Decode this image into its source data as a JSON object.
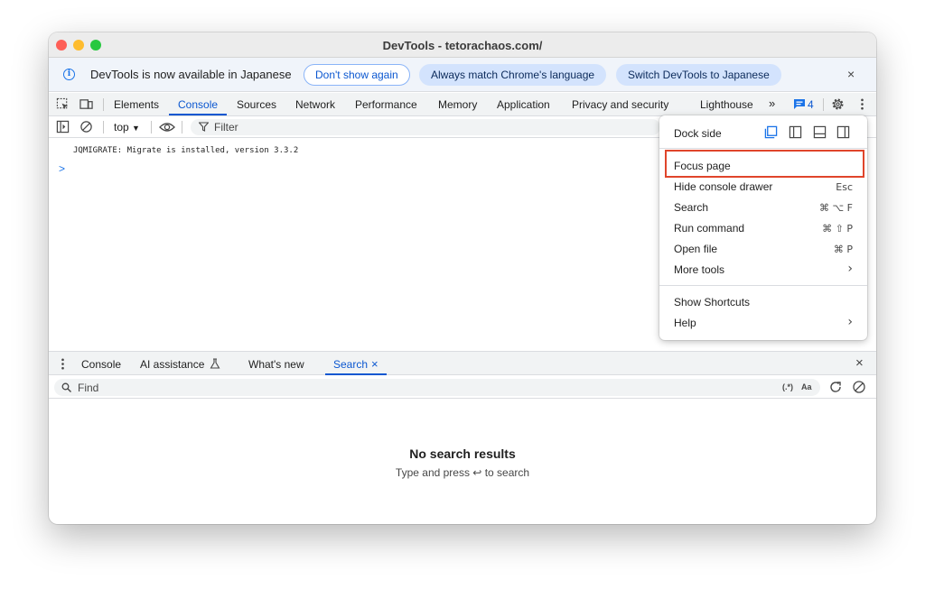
{
  "window": {
    "title": "DevTools - tetorachaos.com/"
  },
  "infobar": {
    "message": "DevTools is now available in Japanese",
    "dont_show": "Don't show again",
    "always_match": "Always match Chrome's language",
    "switch": "Switch DevTools to Japanese",
    "close": "×"
  },
  "tabs": [
    "Elements",
    "Console",
    "Sources",
    "Network",
    "Performance",
    "Memory",
    "Application",
    "Privacy and security",
    "Lighthouse"
  ],
  "active_tab": "Console",
  "tabbar": {
    "more": "»",
    "issues_count": "4"
  },
  "console_toolbar": {
    "context": "top",
    "filter_placeholder": "Filter"
  },
  "console": {
    "line": "JQMIGRATE: Migrate is installed, version 3.3.2",
    "prompt": ">"
  },
  "drawer": {
    "tabs": [
      "Console",
      "AI assistance",
      "What's new",
      "Search"
    ],
    "active_tab": "Search",
    "close": "×",
    "find_placeholder": "Find",
    "regex": "(.*)",
    "match_case": "Aa",
    "no_results_title": "No search results",
    "no_results_hint": "Type and press ↩ to search"
  },
  "menu": {
    "dock_side": "Dock side",
    "items": [
      {
        "label": "Focus page",
        "shortcut": ""
      },
      {
        "label": "Hide console drawer",
        "shortcut": "Esc"
      },
      {
        "label": "Search",
        "shortcut": "⌘ ⌥ F"
      },
      {
        "label": "Run command",
        "shortcut": "⌘ ⇧ P"
      },
      {
        "label": "Open file",
        "shortcut": "⌘ P"
      },
      {
        "label": "More tools",
        "shortcut": "›"
      }
    ],
    "items2": [
      {
        "label": "Show Shortcuts",
        "shortcut": ""
      },
      {
        "label": "Help",
        "shortcut": "›"
      }
    ]
  },
  "colors": {
    "accent": "#0b57d0",
    "highlight": "#e0452b"
  }
}
